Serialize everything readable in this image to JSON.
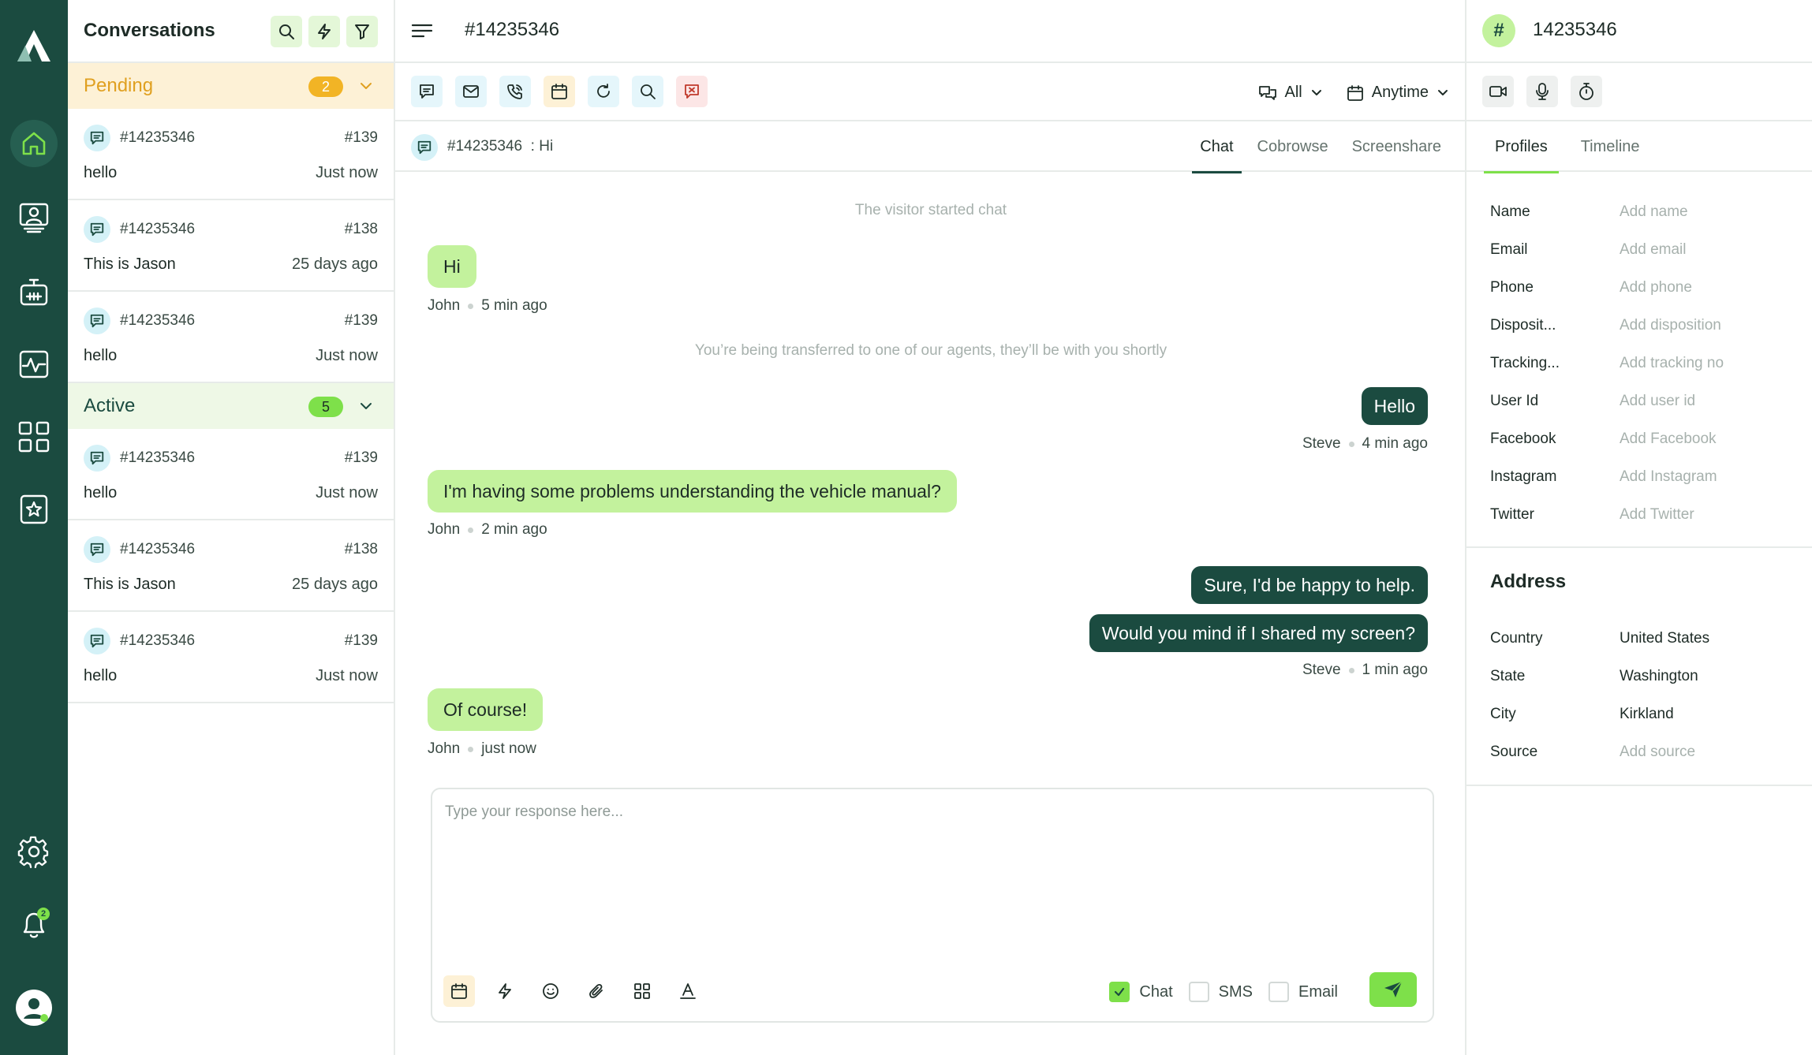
{
  "rail": {
    "icons": [
      "logo",
      "home-icon",
      "agent-monitor-icon",
      "bot-icon",
      "analytics-icon",
      "apps-grid-icon",
      "favorites-icon",
      "settings-icon",
      "bell-icon",
      "user-avatar-icon"
    ],
    "notification_count": "2"
  },
  "list": {
    "title": "Conversations",
    "pending": {
      "label": "Pending",
      "count": "2"
    },
    "active": {
      "label": "Active",
      "count": "5"
    },
    "pending_items": [
      {
        "id": "#14235346",
        "num": "#139",
        "msg": "hello",
        "time": "Just now"
      },
      {
        "id": "#14235346",
        "num": "#138",
        "msg": "This is Jason",
        "time": "25 days ago"
      },
      {
        "id": "#14235346",
        "num": "#139",
        "msg": "hello",
        "time": "Just now"
      }
    ],
    "active_items": [
      {
        "id": "#14235346",
        "num": "#139",
        "msg": "hello",
        "time": "Just now"
      },
      {
        "id": "#14235346",
        "num": "#138",
        "msg": "This is Jason",
        "time": "25 days ago"
      },
      {
        "id": "#14235346",
        "num": "#139",
        "msg": "hello",
        "time": "Just now"
      }
    ]
  },
  "main": {
    "title": "#14235346",
    "filters": {
      "channel": "All",
      "time": "Anytime"
    },
    "sub": {
      "id": "#14235346",
      "preview": ": Hi"
    },
    "tabs": [
      "Chat",
      "Cobrowse",
      "Screenshare"
    ],
    "system": {
      "started": "The visitor started chat",
      "transfer": "You’re being transferred to one of our agents, they’ll be with you shortly"
    },
    "messages": [
      {
        "text": "Hi",
        "author": "John",
        "time": "5 min ago"
      },
      {
        "text": "Hello",
        "author": "Steve",
        "time": "4 min ago"
      },
      {
        "text": "I'm having some problems understanding the vehicle manual?",
        "author": "John",
        "time": "2 min ago"
      },
      {
        "text": "Sure, I'd be happy to help.",
        "author": "",
        "time": ""
      },
      {
        "text": "Would you mind if I shared my screen?",
        "author": "Steve",
        "time": "1 min ago"
      },
      {
        "text": "Of course!",
        "author": "John",
        "time": "just now"
      }
    ],
    "composer": {
      "placeholder": "Type your response here...",
      "channels": [
        {
          "label": "Chat",
          "checked": true
        },
        {
          "label": "SMS",
          "checked": false
        },
        {
          "label": "Email",
          "checked": false
        }
      ]
    }
  },
  "side": {
    "hash": "#",
    "title": "14235346",
    "tabs": [
      "Profiles",
      "Timeline"
    ],
    "profile": [
      {
        "label": "Name",
        "value": "Add name"
      },
      {
        "label": "Email",
        "value": "Add email"
      },
      {
        "label": "Phone",
        "value": "Add phone"
      },
      {
        "label": "Disposit...",
        "value": "Add disposition"
      },
      {
        "label": "Tracking...",
        "value": "Add tracking no"
      },
      {
        "label": "User Id",
        "value": "Add user id"
      },
      {
        "label": "Facebook",
        "value": "Add Facebook"
      },
      {
        "label": "Instagram",
        "value": "Add Instagram"
      },
      {
        "label": "Twitter",
        "value": "Add Twitter"
      }
    ],
    "address_title": "Address",
    "address": [
      {
        "label": "Country",
        "value": "United States"
      },
      {
        "label": "State",
        "value": "Washington"
      },
      {
        "label": "City",
        "value": "Kirkland"
      },
      {
        "label": "Source",
        "value": "Add source"
      }
    ]
  },
  "colors": {
    "rail": "#1b4b40",
    "accent": "#7ee04a",
    "incoming": "#c3f29d",
    "outgoing": "#1b4b40",
    "pending": "#f2b425"
  }
}
